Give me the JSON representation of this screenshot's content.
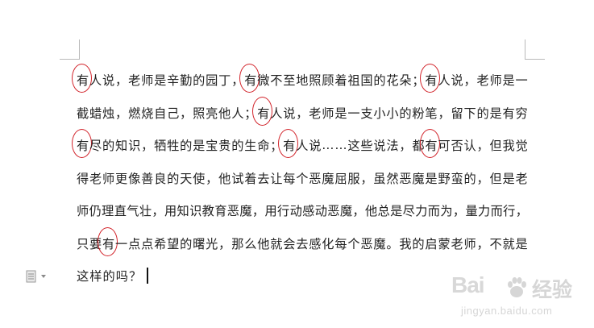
{
  "document": {
    "lines": [
      {
        "segments": [
          {
            "text": "有",
            "circled": true
          },
          {
            "text": "人说，老师是辛勤的园丁，"
          },
          {
            "text": "有",
            "circled": true
          },
          {
            "text": "微不至地照顾着祖国的花朵；"
          },
          {
            "text": "有",
            "circled": true
          },
          {
            "text": "人说，老师是一"
          }
        ]
      },
      {
        "segments": [
          {
            "text": "截蜡烛，燃烧自己，照亮他人；"
          },
          {
            "text": "有",
            "circled": true
          },
          {
            "text": "人说，老师是一支小小的粉笔，留下的是有穷"
          }
        ]
      },
      {
        "segments": [
          {
            "text": "有",
            "circled": true
          },
          {
            "text": "尽的知识，牺牲的是宝贵的生命；"
          },
          {
            "text": "有",
            "circled": true
          },
          {
            "text": "人说……这些说法，都"
          },
          {
            "text": "有",
            "circled": true
          },
          {
            "text": "可否认，但我觉"
          }
        ]
      },
      {
        "segments": [
          {
            "text": "得老师更像善良的天使，他试着去让每个恶魔屈服，虽然恶魔是野蛮的，但是老"
          }
        ]
      },
      {
        "segments": [
          {
            "text": "师仍理直气壮，用知识教育恶魔，用行动感动恶魔，他总是尽力而为，量力而行，"
          }
        ]
      },
      {
        "segments": [
          {
            "text": "只要"
          },
          {
            "text": "有",
            "circled": true
          },
          {
            "text": "一点点希望的曙光，那么他就会去感化每个恶魔。我的启蒙老师，不就是"
          }
        ]
      },
      {
        "segments": [
          {
            "text": "这样的吗？"
          }
        ],
        "caret": true,
        "last": true
      }
    ]
  },
  "icons": {
    "paste_options": "document-icon",
    "paste_dropdown": "chevron-down-icon"
  },
  "watermark": {
    "logo": "Bai",
    "logo_suffix": "经验",
    "url": "jingyan.baidu.com"
  },
  "colors": {
    "circle": "#d2242b",
    "text": "#222222",
    "watermark": "#d6d6d6"
  }
}
